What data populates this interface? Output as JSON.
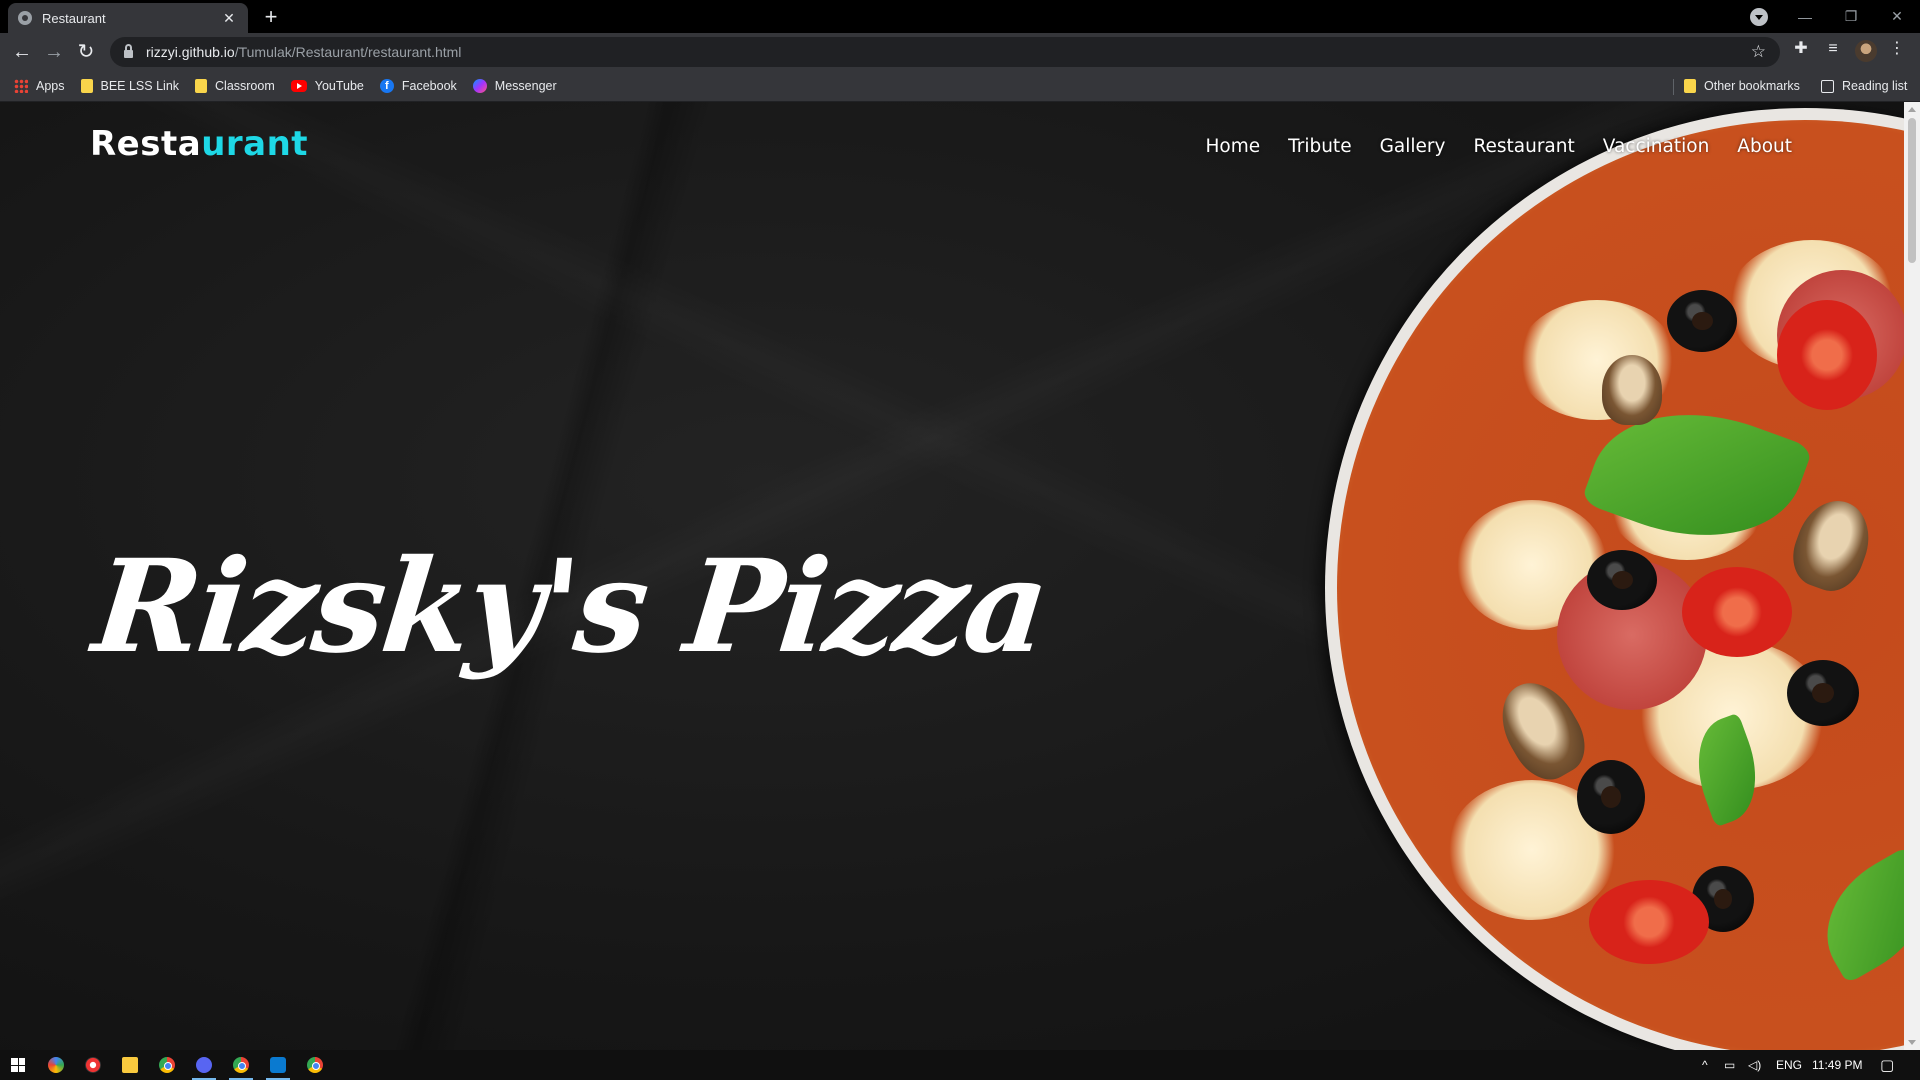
{
  "browser": {
    "tab_title": "Restaurant",
    "tab_close": "✕",
    "new_tab": "+",
    "url_host": "rizzyi.github.io",
    "url_path": "/Tumulak/Restaurant/restaurant.html",
    "window_controls": {
      "minimize": "—",
      "restore": "❐",
      "close": "✕"
    }
  },
  "bookmarks": {
    "items": [
      {
        "label": "Apps",
        "icon": "apps-grid-icon"
      },
      {
        "label": "BEE LSS Link",
        "icon": "folder-icon"
      },
      {
        "label": "Classroom",
        "icon": "folder-icon"
      },
      {
        "label": "YouTube",
        "icon": "youtube-icon"
      },
      {
        "label": "Facebook",
        "icon": "facebook-icon"
      },
      {
        "label": "Messenger",
        "icon": "messenger-icon"
      }
    ],
    "other": "Other bookmarks",
    "reading_list": "Reading list"
  },
  "site": {
    "logo_part1": "Resta",
    "logo_part2": "urant",
    "logo_accent_color": "#1ed8e6",
    "nav": [
      "Home",
      "Tribute",
      "Gallery",
      "Restaurant",
      "Vaccination",
      "About"
    ],
    "hero_title": "Rizsky's Pizza",
    "hero_image": "pizza-image"
  },
  "taskbar": {
    "language": "ENG",
    "time": "11:49 PM"
  }
}
